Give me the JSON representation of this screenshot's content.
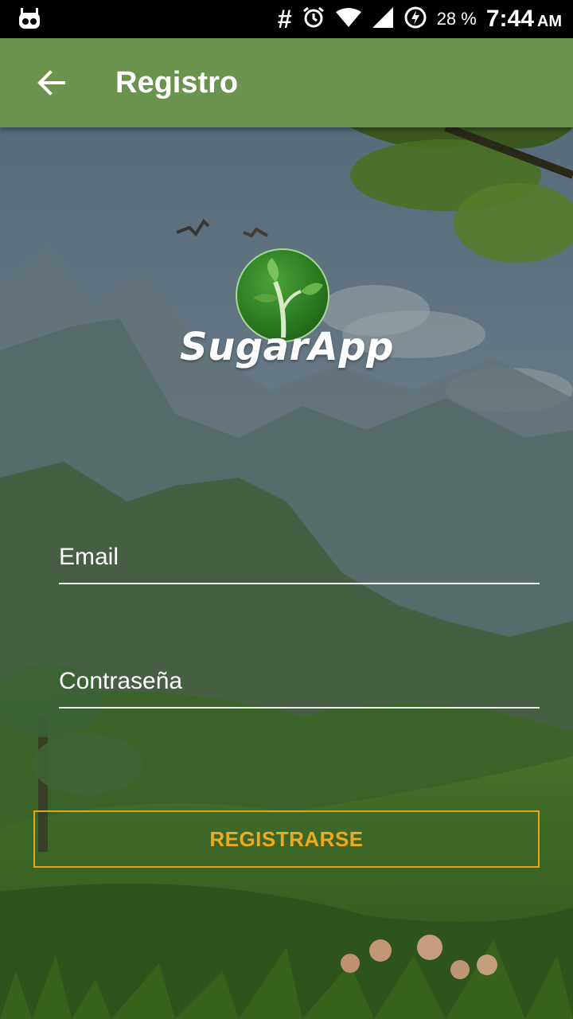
{
  "status_bar": {
    "notification_icon": "robot-icon",
    "hash_symbol": "#",
    "battery_percent": "28 %",
    "time": "7:44",
    "ampm": "AM"
  },
  "app_bar": {
    "title": "Registro",
    "back_icon": "arrow-left-icon"
  },
  "logo": {
    "text": "SugarApp"
  },
  "form": {
    "email_placeholder": "Email",
    "password_placeholder": "Contraseña",
    "register_label": "REGISTRARSE"
  },
  "colors": {
    "app_bar": "#6a934d",
    "button_accent": "#f0a91c"
  }
}
